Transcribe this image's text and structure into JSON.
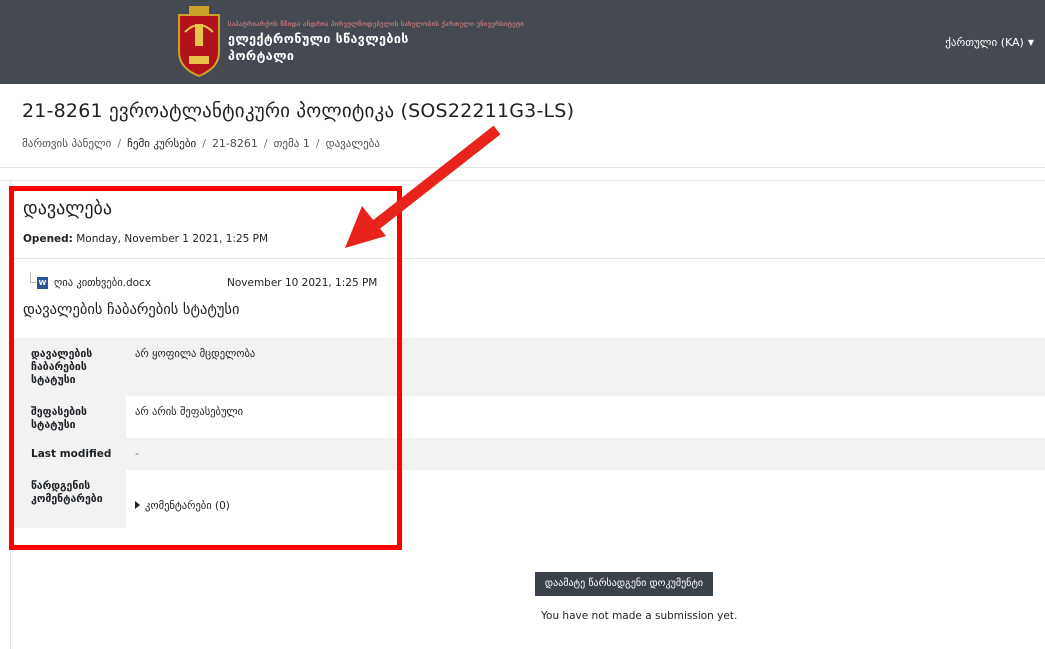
{
  "header": {
    "brand_small": "საპატრიარქოს წმიდა ანდრია პირველწოდებულის სახელობის ქართული უნივერსიტეტი",
    "brand_line1": "ელექტრონული სწავლების",
    "brand_line2": "პორტალი",
    "language": "ქართული (KA)",
    "colors": {
      "bar": "#454a52",
      "highlight": "#ff0000"
    }
  },
  "course": {
    "title": "21-8261 ევროატლანტიკური პოლიტიკა (SOS22211G3-LS)"
  },
  "breadcrumb": [
    "მართვის პანელი",
    "ჩემი კურსები",
    "21-8261",
    "თემა 1",
    "დავალება"
  ],
  "assignment": {
    "title": "დავალება",
    "opened_label": "Opened:",
    "opened_value": "Monday, November 1 2021, 1:25 PM",
    "file_name": "ღია კითხვები.docx",
    "file_date": "November 10 2021, 1:25 PM",
    "file_icon": "word-doc-icon"
  },
  "submission_status": {
    "heading": "დავალების ჩაბარების სტატუსი",
    "rows": [
      {
        "label": "დავალების ჩაბარების სტატუსი",
        "value": "არ ყოფილა მცდელობა"
      },
      {
        "label": "შეფასების სტატუსი",
        "value": "არ არის შეფასებული"
      },
      {
        "label": "Last modified",
        "value": "-"
      },
      {
        "label": "წარდგენის კომენტარები",
        "value": "კომენტარები (0)"
      }
    ]
  },
  "actions": {
    "add_submission": "დაამატე წარსადგენი დოკუმენტი",
    "no_submission": "You have not made a submission yet."
  }
}
